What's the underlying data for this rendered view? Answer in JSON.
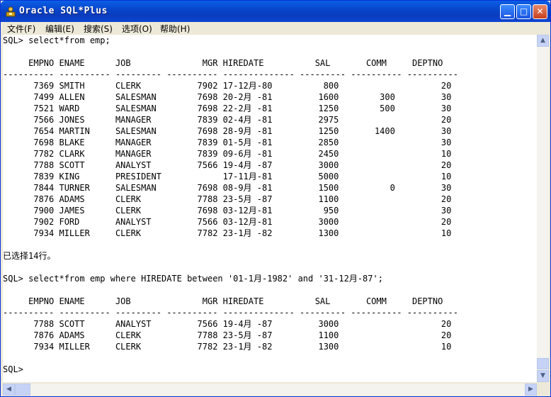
{
  "window": {
    "title": "Oracle SQL*Plus"
  },
  "menu": [
    "文件(F)",
    "编辑(E)",
    "搜索(S)",
    "选项(O)",
    "帮助(H)"
  ],
  "console": {
    "lines": [
      "SQL> select*from emp;",
      "",
      "     EMPNO ENAME      JOB              MGR HIREDATE          SAL       COMM     DEPTNO",
      "---------- ---------- --------- ---------- -------------- --------- ---------- ----------",
      "      7369 SMITH      CLERK           7902 17-12月-80          800                    20",
      "      7499 ALLEN      SALESMAN        7698 20-2月 -81         1600        300         30",
      "      7521 WARD       SALESMAN        7698 22-2月 -81         1250        500         30",
      "      7566 JONES      MANAGER         7839 02-4月 -81         2975                    20",
      "      7654 MARTIN     SALESMAN        7698 28-9月 -81         1250       1400         30",
      "      7698 BLAKE      MANAGER         7839 01-5月 -81         2850                    30",
      "      7782 CLARK      MANAGER         7839 09-6月 -81         2450                    10",
      "      7788 SCOTT      ANALYST         7566 19-4月 -87         3000                    20",
      "      7839 KING       PRESIDENT            17-11月-81         5000                    10",
      "      7844 TURNER     SALESMAN        7698 08-9月 -81         1500          0         30",
      "      7876 ADAMS      CLERK           7788 23-5月 -87         1100                    20",
      "      7900 JAMES      CLERK           7698 03-12月-81          950                    30",
      "      7902 FORD       ANALYST         7566 03-12月-81         3000                    20",
      "      7934 MILLER     CLERK           7782 23-1月 -82         1300                    10",
      "",
      "已选择14行。",
      "",
      "SQL> select*from emp where HIREDATE between '01-1月-1982' and '31-12月-87';",
      "",
      "     EMPNO ENAME      JOB              MGR HIREDATE          SAL       COMM     DEPTNO",
      "---------- ---------- --------- ---------- -------------- --------- ---------- ----------",
      "      7788 SCOTT      ANALYST         7566 19-4月 -87         3000                    20",
      "      7876 ADAMS      CLERK           7788 23-5月 -87         1100                    20",
      "      7934 MILLER     CLERK           7782 23-1月 -82         1300                    10",
      "",
      "SQL>"
    ]
  },
  "icons": {
    "app": "sqlplus-app-icon",
    "minimize": "minimize-icon",
    "maximize": "maximize-icon",
    "close": "close-icon"
  },
  "colors": {
    "title_bar": "#0a4fd8",
    "console_bg": "#ffffff",
    "text": "#000000"
  }
}
